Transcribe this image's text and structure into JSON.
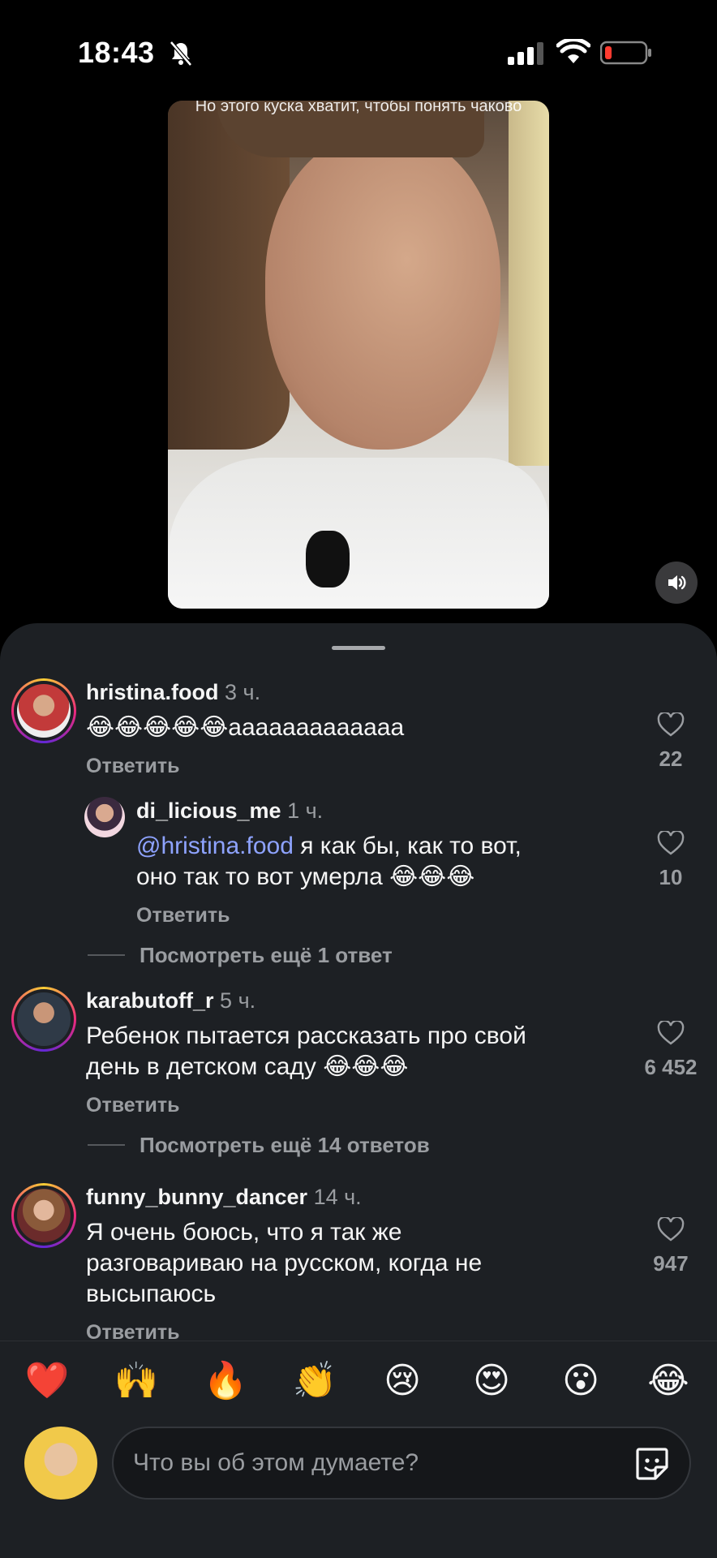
{
  "status_bar": {
    "time": "18:43",
    "icons": [
      "bell-slash-icon",
      "signal-icon",
      "wifi-icon",
      "battery-low-icon"
    ]
  },
  "video": {
    "caption": "Но этого куска хватит, чтобы понять чаково",
    "sound_icon": "speaker-icon"
  },
  "comments": [
    {
      "username": "hristina.food",
      "time": "3 ч.",
      "text": "😂😂😂😂😂ааааааааааааа",
      "reply_label": "Ответить",
      "likes": "22",
      "replies": [
        {
          "username": "di_licious_me",
          "time": "1 ч.",
          "mention": "@hristina.food",
          "text_line1": " я как бы, как то вот,",
          "text_line2": "оно так то вот умерла 😂😂😂",
          "reply_label": "Ответить",
          "likes": "10"
        }
      ],
      "more_replies": "Посмотреть ещё 1 ответ"
    },
    {
      "username": "karabutoff_r",
      "time": "5 ч.",
      "text_line1": "Ребенок пытается рассказать про свой",
      "text_line2": "день в детском саду 😂😂😂",
      "reply_label": "Ответить",
      "likes": "6 452",
      "more_replies": "Посмотреть ещё 14 ответов"
    },
    {
      "username": "funny_bunny_dancer",
      "time": "14 ч.",
      "text_line1": "Я очень боюсь, что я так же",
      "text_line2": "разговариваю на русском, когда не",
      "text_line3": "высыпаюсь",
      "reply_label": "Ответить",
      "likes": "947"
    }
  ],
  "emoji_bar": [
    "❤️",
    "🙌",
    "🔥",
    "👏",
    "😢",
    "😍",
    "😮",
    "😂"
  ],
  "input": {
    "placeholder": "Что вы об этом думаете?",
    "sticker_icon": "sticker-icon"
  },
  "colors": {
    "sheet_bg": "#1d2024",
    "mention": "#8ea3ff",
    "muted": "#9a9da1"
  }
}
